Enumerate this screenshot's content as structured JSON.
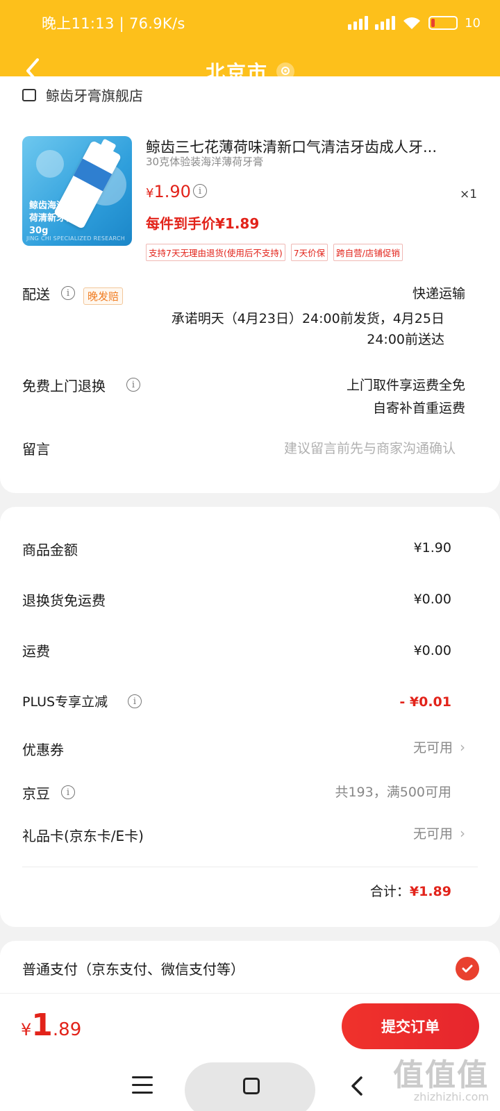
{
  "status_bar": {
    "time": "晚上11:13 | 76.9K/s",
    "battery": "10"
  },
  "nav": {
    "title": "北京市"
  },
  "store": {
    "name": "鲸齿牙膏旗舰店"
  },
  "product": {
    "title": "鲸齿三七花薄荷味清新口气清洁牙齿成人牙...",
    "spec": "30克体验装海洋薄荷牙膏",
    "price_symbol": "¥",
    "price": "1.90",
    "quantity": "×1",
    "final_price": "每件到手价¥1.89",
    "thumb_text": "鲸齿海洋薄荷清新牙膏30g",
    "thumb_footer": "JING CHI SPECIALIZED RESEARCH",
    "tags": [
      "支持7天无理由退货(使用后不支持)",
      "7天价保",
      "跨自营/店铺促销"
    ]
  },
  "delivery": {
    "label": "配送",
    "badge": "晚发赔",
    "method": "快递运输",
    "promise_line1": "承诺明天（4月23日）24:00前发货，4月25日",
    "promise_line2": "24:00前送达"
  },
  "returns": {
    "label": "免费上门退换",
    "line1": "上门取件享运费全免",
    "line2": "自寄补首重运费"
  },
  "message": {
    "label": "留言",
    "placeholder": "建议留言前先与商家沟通确认"
  },
  "summary": {
    "goods_label": "商品金额",
    "goods_value": "¥1.90",
    "return_shipping_label": "退换货免运费",
    "return_shipping_value": "¥0.00",
    "shipping_label": "运费",
    "shipping_value": "¥0.00",
    "plus_label": "PLUS专享立减",
    "plus_value": "- ¥0.01",
    "coupon_label": "优惠券",
    "coupon_value": "无可用",
    "beans_label": "京豆",
    "beans_value": "共193，满500可用",
    "giftcard_label": "礼品卡(京东卡/E卡)",
    "giftcard_value": "无可用",
    "total_label": "合计：",
    "total_value": "¥1.89"
  },
  "payment": {
    "label": "普通支付（京东支付、微信支付等）"
  },
  "bottom": {
    "yen": "¥",
    "int": "1",
    "dec": ".89",
    "submit": "提交订单"
  },
  "watermark": {
    "main": "值值值",
    "sub": "zhizhizhi.com"
  },
  "colors": {
    "header": "#fdc01b",
    "accent_red": "#e2231a",
    "badge_orange": "#f07c21"
  }
}
